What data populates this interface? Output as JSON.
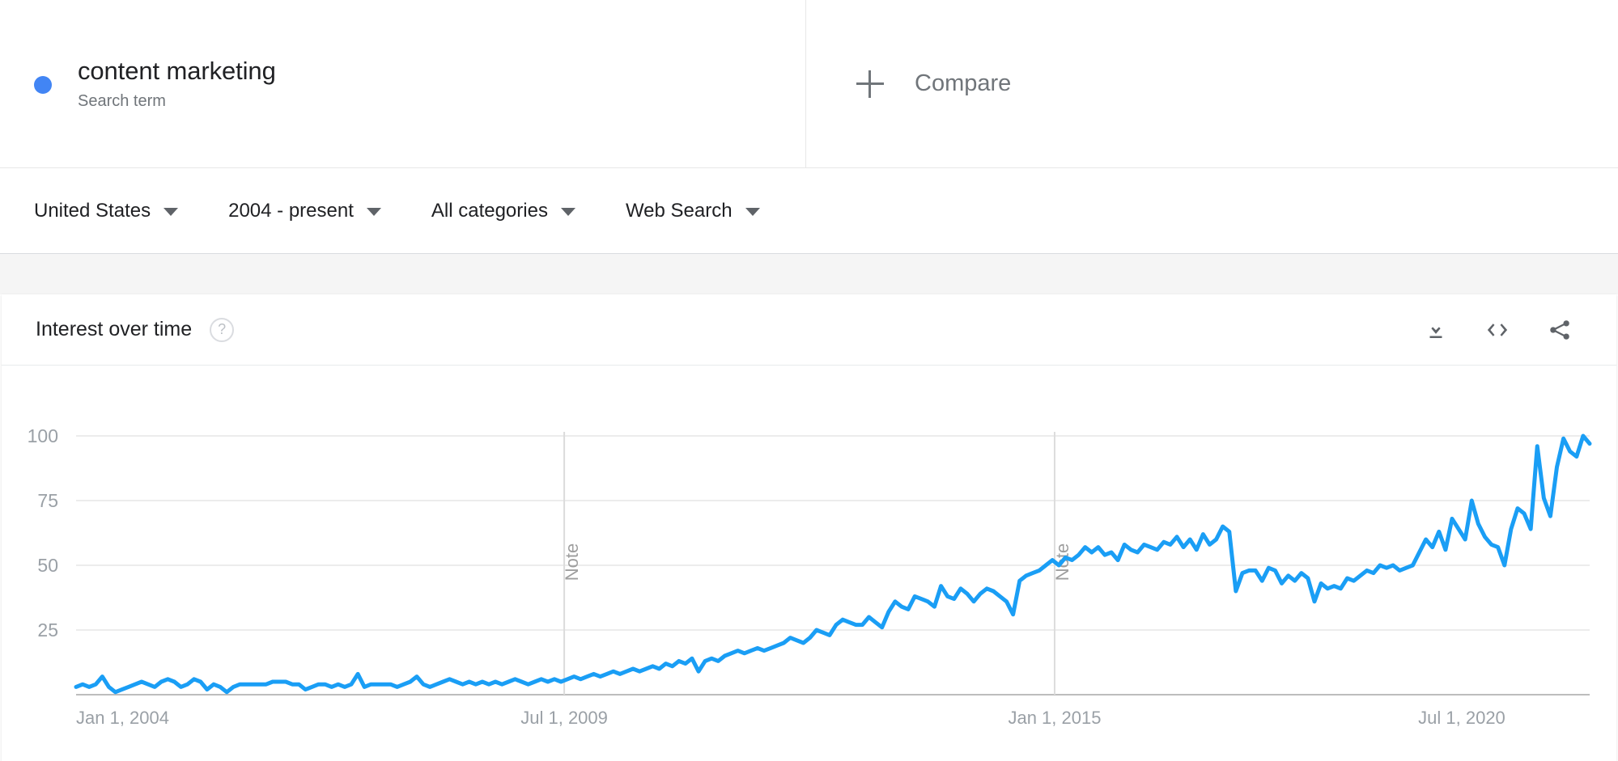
{
  "colors": {
    "legend_dot": "#4285F4",
    "line": "#1A9EF5",
    "gridline": "#e6e6e6",
    "axis_text": "#9aa0a6"
  },
  "header": {
    "term": {
      "label": "content marketing",
      "type_label": "Search term"
    },
    "compare_label": "Compare"
  },
  "filters": [
    {
      "label": "United States"
    },
    {
      "label": "2004 - present"
    },
    {
      "label": "All categories"
    },
    {
      "label": "Web Search"
    }
  ],
  "card": {
    "title": "Interest over time",
    "help_glyph": "?",
    "actions": [
      {
        "name": "download",
        "label": "Download CSV"
      },
      {
        "name": "embed",
        "label": "Embed"
      },
      {
        "name": "share",
        "label": "Share"
      }
    ]
  },
  "chart_data": {
    "type": "line",
    "title": "Interest over time",
    "xlabel": "",
    "ylabel": "",
    "ylim": [
      0,
      100
    ],
    "yticks": [
      25,
      50,
      75,
      100
    ],
    "xticks": [
      "Jan 1, 2004",
      "Jul 1, 2009",
      "Jan 1, 2015",
      "Jul 1, 2020"
    ],
    "xtick_positions": [
      0.0,
      0.3225,
      0.6465,
      0.9155
    ],
    "grid": true,
    "legend_position": "top-left",
    "annotations": [
      {
        "label": "Note",
        "x_fraction": 0.3225
      },
      {
        "label": "Note",
        "x_fraction": 0.6465
      }
    ],
    "series": [
      {
        "name": "content marketing",
        "color": "#1A9EF5",
        "x_start": "Jan 1, 2004",
        "x_end": "Nov 1, 2022",
        "interval": "monthly",
        "values": [
          3,
          4,
          3,
          4,
          7,
          3,
          1,
          2,
          3,
          4,
          5,
          4,
          3,
          5,
          6,
          5,
          3,
          4,
          6,
          5,
          2,
          4,
          3,
          1,
          3,
          4,
          4,
          4,
          4,
          4,
          5,
          5,
          5,
          4,
          4,
          2,
          3,
          4,
          4,
          3,
          4,
          3,
          4,
          8,
          3,
          4,
          4,
          4,
          4,
          3,
          4,
          5,
          7,
          4,
          3,
          4,
          5,
          6,
          5,
          4,
          5,
          4,
          5,
          4,
          5,
          4,
          5,
          6,
          5,
          4,
          5,
          6,
          5,
          6,
          5,
          6,
          7,
          6,
          7,
          8,
          7,
          8,
          9,
          8,
          9,
          10,
          9,
          10,
          11,
          10,
          12,
          11,
          13,
          12,
          14,
          9,
          13,
          14,
          13,
          15,
          16,
          17,
          16,
          17,
          18,
          17,
          18,
          19,
          20,
          22,
          21,
          20,
          22,
          25,
          24,
          23,
          27,
          29,
          28,
          27,
          27,
          30,
          28,
          26,
          32,
          36,
          34,
          33,
          38,
          37,
          36,
          34,
          42,
          38,
          37,
          41,
          39,
          36,
          39,
          41,
          40,
          38,
          36,
          31,
          44,
          46,
          47,
          48,
          50,
          52,
          50,
          53,
          52,
          54,
          57,
          55,
          57,
          54,
          55,
          52,
          58,
          56,
          55,
          58,
          57,
          56,
          59,
          58,
          61,
          57,
          60,
          56,
          62,
          58,
          60,
          65,
          63,
          40,
          47,
          48,
          48,
          44,
          49,
          48,
          43,
          46,
          44,
          47,
          45,
          36,
          43,
          41,
          42,
          41,
          45,
          44,
          46,
          48,
          47,
          50,
          49,
          50,
          48,
          49,
          50,
          55,
          60,
          57,
          63,
          56,
          68,
          64,
          60,
          75,
          66,
          61,
          58,
          57,
          50,
          64,
          72,
          70,
          64,
          96,
          76,
          69,
          88,
          99,
          94,
          92,
          100,
          97
        ]
      }
    ]
  }
}
